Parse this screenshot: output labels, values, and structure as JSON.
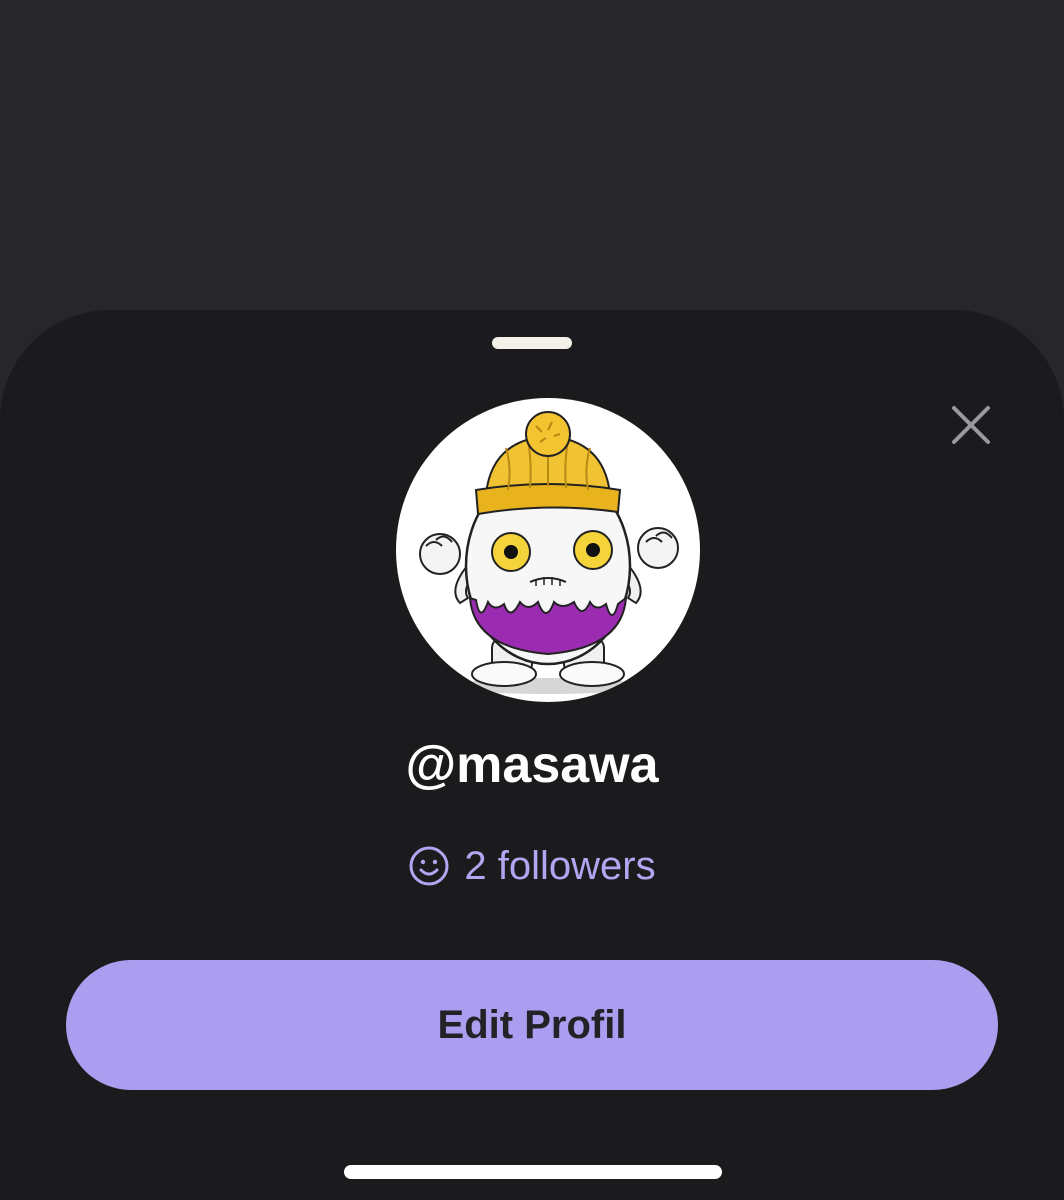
{
  "profile": {
    "username": "@masawa",
    "followers_text": "2 followers",
    "avatar_icon": "monster-mascot-avatar"
  },
  "actions": {
    "edit_label": "Edit Profil",
    "close_icon": "close-icon"
  },
  "colors": {
    "backdrop": "#27272a",
    "sheet": "#1b1b1d",
    "accent": "#ab9ef0",
    "followers_text": "#b1a6f1"
  }
}
